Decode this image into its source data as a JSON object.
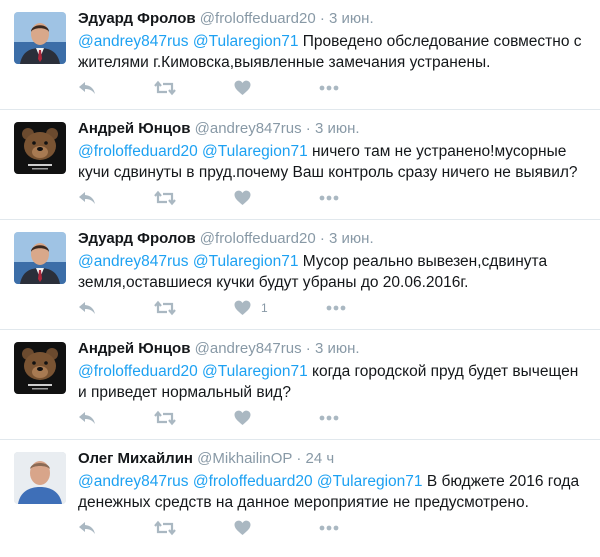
{
  "tweets": [
    {
      "name": "Эдуард Фролов",
      "handle": "@froloffeduard20",
      "time": "3 июн.",
      "avatar": "man-in-suit",
      "parts": [
        {
          "t": "@andrey847rus",
          "m": true
        },
        {
          "t": " ",
          "m": false
        },
        {
          "t": "@Tularegion71",
          "m": true
        },
        {
          "t": " Проведено обследование совместно с жителями г.Кимовска,выявленные замечания устранены.",
          "m": false
        }
      ],
      "likes": ""
    },
    {
      "name": "Андрей Юнцов",
      "handle": "@andrey847rus",
      "time": "3 июн.",
      "avatar": "bear",
      "parts": [
        {
          "t": "@froloffeduard20",
          "m": true
        },
        {
          "t": " ",
          "m": false
        },
        {
          "t": "@Tularegion71",
          "m": true
        },
        {
          "t": " ничего там не устранено!мусорные кучи сдвинуты в пруд.почему Ваш контроль сразу ничего не выявил?",
          "m": false
        }
      ],
      "likes": ""
    },
    {
      "name": "Эдуард Фролов",
      "handle": "@froloffeduard20",
      "time": "3 июн.",
      "avatar": "man-in-suit",
      "parts": [
        {
          "t": "@andrey847rus",
          "m": true
        },
        {
          "t": " ",
          "m": false
        },
        {
          "t": "@Tularegion71",
          "m": true
        },
        {
          "t": " Мусор реально вывезен,сдвинута земля,оставшиеся кучки будут убраны до 20.06.2016г.",
          "m": false
        }
      ],
      "likes": "1"
    },
    {
      "name": "Андрей Юнцов",
      "handle": "@andrey847rus",
      "time": "3 июн.",
      "avatar": "bear",
      "parts": [
        {
          "t": "@froloffeduard20",
          "m": true
        },
        {
          "t": " ",
          "m": false
        },
        {
          "t": "@Tularegion71",
          "m": true
        },
        {
          "t": " когда городской пруд будет вычещен и приведет нормальный вид?",
          "m": false
        }
      ],
      "likes": ""
    },
    {
      "name": "Олег Михайлин",
      "handle": "@MikhailinOP",
      "time": "24 ч",
      "avatar": "man-photo",
      "parts": [
        {
          "t": "@andrey847rus",
          "m": true
        },
        {
          "t": " ",
          "m": false
        },
        {
          "t": "@froloffeduard20",
          "m": true
        },
        {
          "t": " ",
          "m": false
        },
        {
          "t": "@Tularegion71",
          "m": true
        },
        {
          "t": " В бюджете 2016 года денежных средств на данное мероприятие не предусмотрено.",
          "m": false
        }
      ],
      "likes": ""
    }
  ],
  "actions": [
    "reply-icon",
    "retweet-icon",
    "like-icon",
    "more-icon"
  ],
  "colors": {
    "mention": "#1da1f2",
    "meta": "#8899a6",
    "icon": "#aab8c2",
    "divider": "#e1e8ed"
  }
}
